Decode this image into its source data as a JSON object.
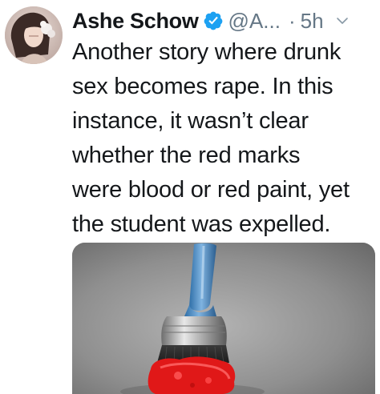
{
  "tweet": {
    "author_name": "Ashe Schow",
    "handle": "@A...",
    "separator": "·",
    "time": "5h",
    "text": "Another story where drunk\nsex becomes rape. In this\ninstance, it wasn’t clear\nwhether the red marks\nwere blood or red paint, yet\nthe student was expelled."
  },
  "icons": {
    "verified": "verified-badge-icon",
    "menu": "chevron-down-icon"
  },
  "colors": {
    "verified_blue": "#1da1f2",
    "muted_text": "#657786",
    "primary_text": "#14171a"
  }
}
